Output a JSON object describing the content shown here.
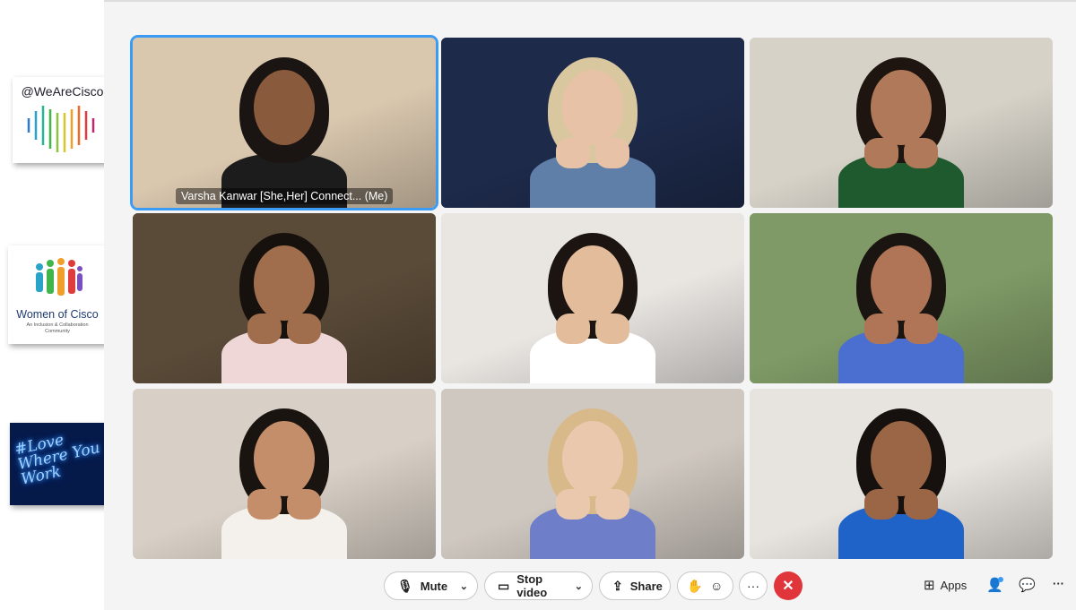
{
  "sidebar": {
    "cisco_handle": "@WeAreCisco",
    "woc_title": "Women of Cisco",
    "woc_subtitle": "An Inclusion & Collaboration Community",
    "neon_text": "#Love Where You Work"
  },
  "participants": [
    {
      "name_label": "Varsha Kanwar [She,Her] Connect...  (Me)",
      "active": true,
      "bg": "#d9c7ae",
      "hair": "#1a1412",
      "skin": "#8a5a3c",
      "top": "#1c1c1c"
    },
    {
      "name_label": "",
      "bg": "#1d2a4a",
      "hair": "#d9c7a0",
      "skin": "#e8c2a6",
      "top": "#5f7ea8"
    },
    {
      "name_label": "",
      "bg": "#d6d2c8",
      "hair": "#1e1511",
      "skin": "#b07a5a",
      "top": "#1f5a2e"
    },
    {
      "name_label": "",
      "bg": "#5a4a38",
      "hair": "#17110e",
      "skin": "#a06e4c",
      "top": "#f0d7d7"
    },
    {
      "name_label": "",
      "bg": "#e9e6e2",
      "hair": "#1b1410",
      "skin": "#e3bd9b",
      "top": "#ffffff"
    },
    {
      "name_label": "",
      "bg": "#7f9a66",
      "hair": "#1b1512",
      "skin": "#b07556",
      "top": "#4a6fd1"
    },
    {
      "name_label": "",
      "bg": "#d8d0c6",
      "hair": "#1a1410",
      "skin": "#c48e6a",
      "top": "#f4f0ec"
    },
    {
      "name_label": "",
      "bg": "#cfc8c0",
      "hair": "#d8b98a",
      "skin": "#eac8ad",
      "top": "#6f7ec9"
    },
    {
      "name_label": "",
      "bg": "#e7e3de",
      "hair": "#16110e",
      "skin": "#9a6646",
      "top": "#1f63c9"
    }
  ],
  "controls": {
    "mute_label": "Mute",
    "stop_video_label": "Stop video",
    "share_label": "Share",
    "apps_label": "Apps",
    "more_label": "···"
  },
  "colors": {
    "active_speaker_border": "#3c9bf5",
    "end_call": "#e0353a"
  }
}
